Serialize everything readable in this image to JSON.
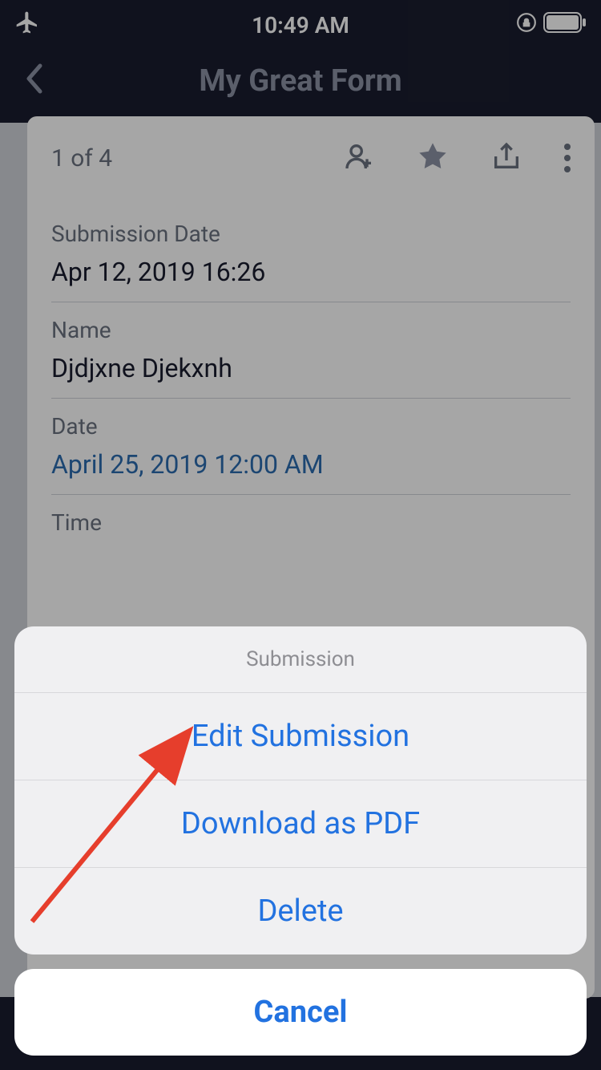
{
  "statusBar": {
    "time": "10:49 AM"
  },
  "nav": {
    "title": "My Great Form"
  },
  "card": {
    "count": "1 of 4",
    "fields": [
      {
        "label": "Submission Date",
        "value": "Apr 12, 2019 16:26",
        "link": false
      },
      {
        "label": "Name",
        "value": "Djdjxne Djekxnh",
        "link": false
      },
      {
        "label": "Date",
        "value": "April 25, 2019 12:00 AM",
        "link": true
      },
      {
        "label": "Time",
        "value": "",
        "link": false
      }
    ]
  },
  "actionSheet": {
    "title": "Submission",
    "items": [
      "Edit Submission",
      "Download as PDF",
      "Delete"
    ],
    "cancel": "Cancel"
  }
}
